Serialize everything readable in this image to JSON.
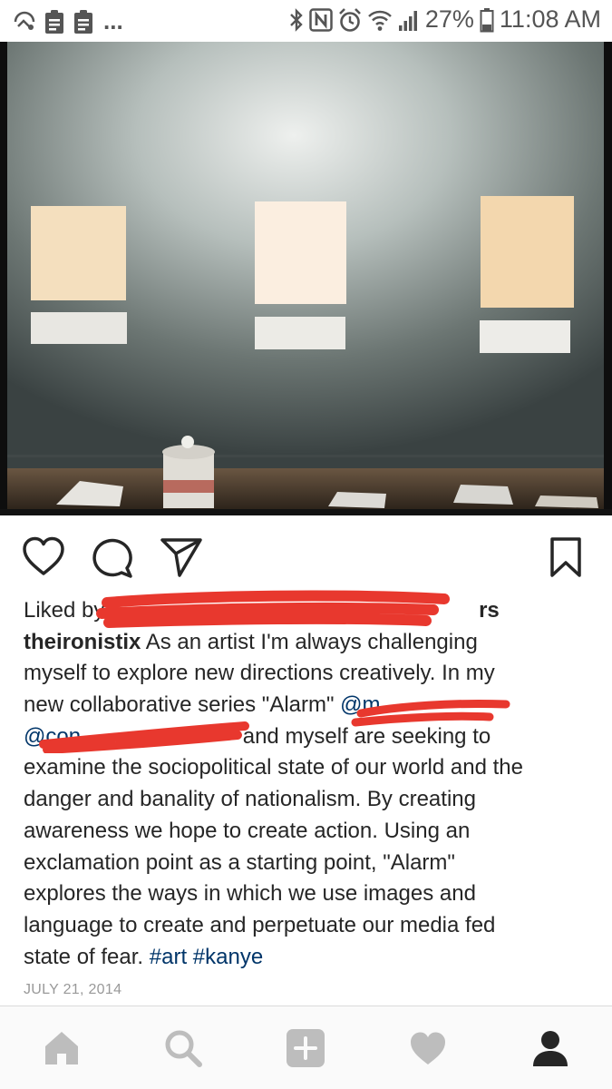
{
  "status_bar": {
    "overflow": "...",
    "battery": "27%",
    "time": "11:08 AM",
    "icons": [
      "cast-icon",
      "clipboard-icon",
      "clipboard-icon",
      "bluetooth-icon",
      "nfc-icon",
      "alarm-icon",
      "wifi-icon",
      "signal-icon",
      "battery-icon"
    ]
  },
  "post": {
    "image_alt": "Gallery wall with three paper panels",
    "actions": {
      "like": "heart-icon",
      "comment": "comment-icon",
      "share": "send-icon",
      "save": "bookmark-icon"
    },
    "likes_prefix": "Liked by ",
    "likes_suffix": "rs",
    "username": "theironistix",
    "caption": {
      "line1": " As an artist I'm always challenging",
      "line2": "myself to explore new directions creatively. In my",
      "line3_text": "new collaborative series \"Alarm\"",
      "line3_mention": " @m",
      "line4_mention": "@con",
      "line4_text": " and myself are seeking to",
      "line5": "examine the sociopolitical state of our world and the",
      "line6": "danger and banality of nationalism. By creating",
      "line7": "awareness we hope to create action. Using an",
      "line8": "exclamation point as a starting point, \"Alarm\"",
      "line9": "explores the ways in which we use images and",
      "line10": "language to create and perpetuate our media fed",
      "line11_text": "state of fear. ",
      "hashtag1": "#art",
      "hashtag2": "#kanye"
    },
    "date": "JULY 21, 2014"
  },
  "bottom_nav": {
    "items": [
      "home-icon",
      "search-icon",
      "add-post-icon",
      "activity-heart-icon",
      "profile-icon"
    ]
  },
  "colors": {
    "text": "#262626",
    "link": "#003569",
    "muted": "#999999",
    "redaction": "#e8382e"
  }
}
